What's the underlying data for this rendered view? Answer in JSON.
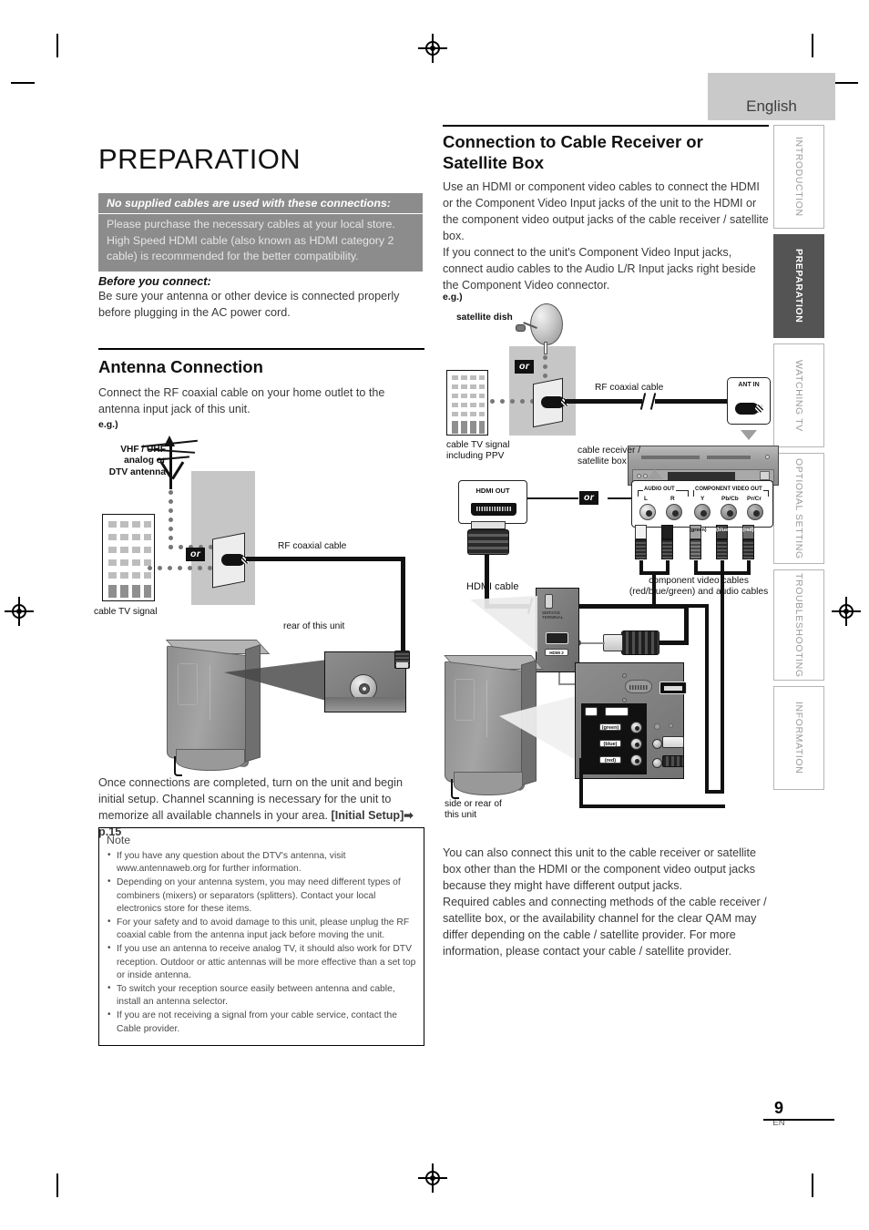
{
  "page": {
    "number": "9",
    "edition": "EN",
    "language_tab": "English"
  },
  "nav_tabs": [
    {
      "label": "INTRODUCTION",
      "active": false
    },
    {
      "label": "PREPARATION",
      "active": true
    },
    {
      "label": "WATCHING TV",
      "active": false
    },
    {
      "label": "OPTIONAL SETTING",
      "active": false
    },
    {
      "label": "TROUBLESHOOTING",
      "active": false
    },
    {
      "label": "INFORMATION",
      "active": false
    }
  ],
  "left_column": {
    "title": "PREPARATION",
    "callout": {
      "heading": "No supplied cables are used with these connections:",
      "body": "Please purchase the necessary cables at your local store. High Speed HDMI cable (also known as HDMI category 2 cable) is recommended for the better compatibility."
    },
    "before_you_connect": {
      "heading": "Before you connect:",
      "body": "Be sure your antenna or other device is connected properly before plugging in the AC power cord."
    },
    "antenna_section": {
      "heading": "Antenna Connection",
      "body": "Connect the RF coaxial cable on your home outlet to the antenna input jack of this unit.",
      "eg": "e.g.)",
      "diagram_labels": {
        "antenna": "VHF / UHF\nanalog or\nDTV antenna",
        "cable_tv_signal": "cable TV signal",
        "or": "or",
        "rf_coaxial_cable": "RF coaxial cable",
        "rear_of_unit": "rear of this unit"
      }
    },
    "closing_paragraph": {
      "text": "Once connections are completed, turn on the unit and begin initial setup. Channel scanning is necessary for the unit to memorize all available channels in your area. ",
      "bold_ref": "[Initial Setup]",
      "arrow": "➡",
      "page_ref": "p.15"
    },
    "note": {
      "title": "Note",
      "items": [
        "If you have any question about the DTV's antenna, visit www.antennaweb.org for further information.",
        "Depending on your antenna system, you may need different types of combiners (mixers) or separators (splitters). Contact your local electronics store for these items.",
        "For your safety and to avoid damage to this unit, please unplug the RF coaxial cable from the antenna input jack before moving the unit.",
        "If you use an antenna to receive analog TV, it should also work for DTV reception. Outdoor or attic antennas will be more effective than a set top or inside antenna.",
        "To switch your reception source easily between antenna and cable, install an antenna selector.",
        "If you are not receiving a signal from your cable service, contact the Cable provider."
      ]
    }
  },
  "right_column": {
    "heading": "Connection to Cable Receiver or Satellite Box",
    "intro_paragraph_1": "Use an HDMI or component video cables to connect the HDMI or the Component Video Input jacks of the unit to the HDMI or the component video output jacks of the cable receiver / satellite box.",
    "intro_paragraph_2": "If you connect to the unit's Component Video Input jacks, connect audio cables to the Audio L/R Input jacks right beside the Component Video connector.",
    "eg": "e.g.)",
    "diagram_labels": {
      "satellite_dish": "satellite dish",
      "cable_tv_signal": "cable TV signal\nincluding PPV",
      "or": "or",
      "rf_coaxial_cable": "RF coaxial cable",
      "ant_in": "ANT IN",
      "cable_receiver": "cable receiver /\nsatellite box",
      "hdmi_out": "HDMI OUT",
      "hdmi_cable": "HDMI cable",
      "audio_out": "AUDIO OUT",
      "component_video_out": "COMPONENT VIDEO OUT",
      "jack_l": "L",
      "jack_r": "R",
      "jack_y": "Y",
      "jack_pbcb": "Pb/Cb",
      "jack_prcr": "Pr/Cr",
      "plug_green": "(green)",
      "plug_blue": "(blue)",
      "plug_red": "(red)",
      "component_cables": "component video cables\n(red/blue/green) and audio cables",
      "side_or_rear": "side or rear of\nthis unit",
      "service_terminal": "SERVICE\nTERMINAL",
      "hdmi_label": "HDMI 2"
    },
    "closing_paragraph_1": "You can also connect this unit to the cable receiver or satellite box other than the HDMI or the component video output jacks because they might have different output jacks.",
    "closing_paragraph_2": "Required cables and connecting methods of the cable receiver / satellite box, or the availability channel for the clear QAM may differ depending on the cable / satellite provider. For more information, please contact your cable / satellite provider."
  },
  "colors": {
    "callout_grey": "#8c8c8c",
    "tab_active": "#545454",
    "tab_inactive_text": "#9a9a9a",
    "lang_tab_bg": "#c9c9c9"
  }
}
